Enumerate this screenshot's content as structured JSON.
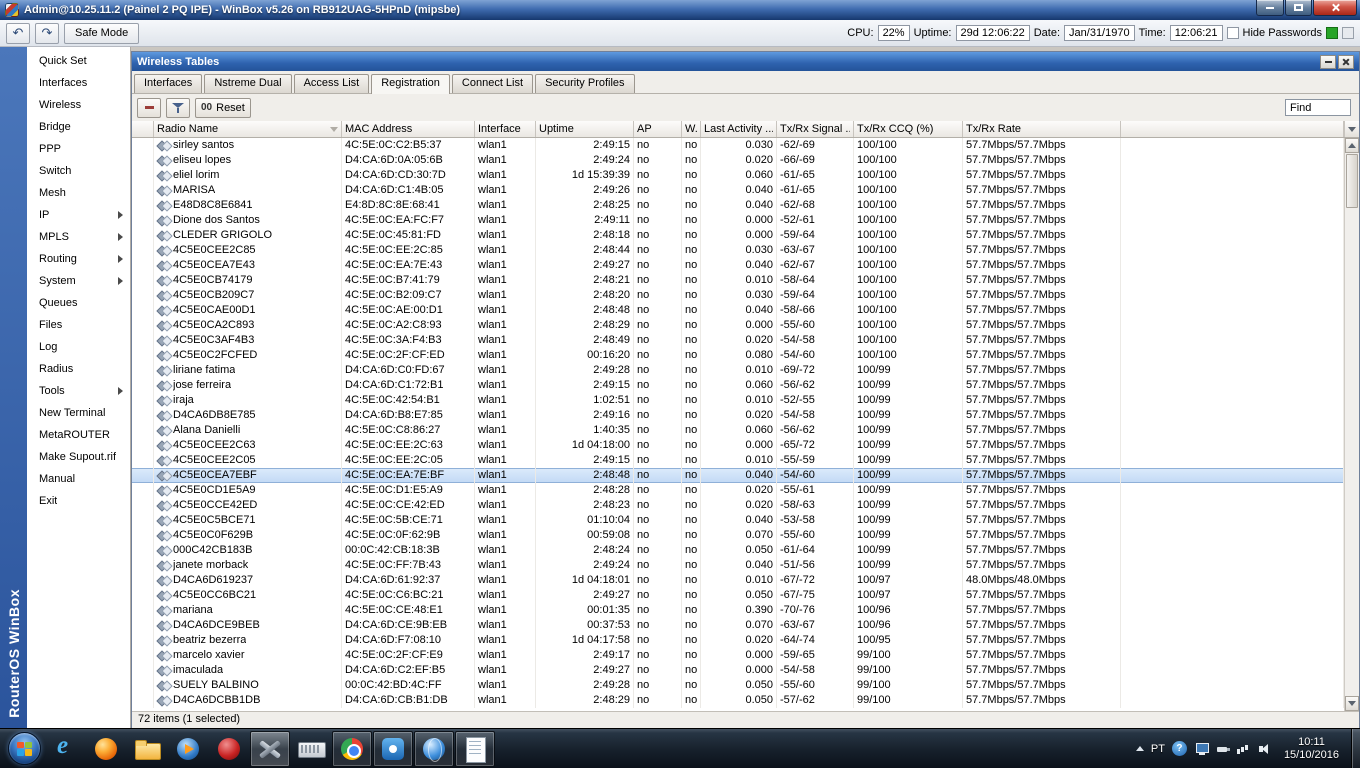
{
  "titlebar": {
    "title": "Admin@10.25.11.2 (Painel 2 PQ IPE) - WinBox v5.26 on RB912UAG-5HPnD (mipsbe)"
  },
  "toolbar": {
    "safe_mode_label": "Safe Mode",
    "cpu_label": "CPU:",
    "cpu_value": "22%",
    "uptime_label": "Uptime:",
    "uptime_value": "29d 12:06:22",
    "date_label": "Date:",
    "date_value": "Jan/31/1970",
    "time_label": "Time:",
    "time_value": "12:06:21",
    "hide_passwords_label": "Hide Passwords"
  },
  "sidebar": {
    "brand": "RouterOS WinBox",
    "items": [
      {
        "id": "quick-set",
        "label": "Quick Set"
      },
      {
        "id": "interfaces",
        "label": "Interfaces"
      },
      {
        "id": "wireless",
        "label": "Wireless"
      },
      {
        "id": "bridge",
        "label": "Bridge"
      },
      {
        "id": "ppp",
        "label": "PPP"
      },
      {
        "id": "switch",
        "label": "Switch"
      },
      {
        "id": "mesh",
        "label": "Mesh"
      },
      {
        "id": "ip",
        "label": "IP",
        "submenu": true
      },
      {
        "id": "mpls",
        "label": "MPLS",
        "submenu": true
      },
      {
        "id": "routing",
        "label": "Routing",
        "submenu": true
      },
      {
        "id": "system",
        "label": "System",
        "submenu": true
      },
      {
        "id": "queues",
        "label": "Queues"
      },
      {
        "id": "files",
        "label": "Files"
      },
      {
        "id": "log",
        "label": "Log"
      },
      {
        "id": "radius",
        "label": "Radius"
      },
      {
        "id": "tools",
        "label": "Tools",
        "submenu": true
      },
      {
        "id": "new-terminal",
        "label": "New Terminal"
      },
      {
        "id": "metarouter",
        "label": "MetaROUTER"
      },
      {
        "id": "make-supout",
        "label": "Make Supout.rif"
      },
      {
        "id": "manual",
        "label": "Manual"
      },
      {
        "id": "exit",
        "label": "Exit"
      }
    ]
  },
  "wireless_window": {
    "title": "Wireless Tables",
    "tabs": [
      {
        "id": "interfaces",
        "label": "Interfaces"
      },
      {
        "id": "nstreme-dual",
        "label": "Nstreme Dual"
      },
      {
        "id": "access-list",
        "label": "Access List"
      },
      {
        "id": "registration",
        "label": "Registration",
        "active": true
      },
      {
        "id": "connect-list",
        "label": "Connect List"
      },
      {
        "id": "security-profiles",
        "label": "Security Profiles"
      }
    ],
    "toolbar": {
      "reset_icon": "00",
      "reset_label": "Reset",
      "find_label": "Find"
    },
    "columns": [
      "Radio Name",
      "MAC Address",
      "Interface",
      "Uptime",
      "AP",
      "W...",
      "Last Activity ...",
      "Tx/Rx Signal ...",
      "Tx/Rx CCQ (%)",
      "Tx/Rx Rate"
    ],
    "rows": [
      {
        "name": "sirley santos",
        "mac": "4C:5E:0C:C2:B5:37",
        "iface": "wlan1",
        "uptime": "2:49:15",
        "ap": "no",
        "w": "no",
        "last": "0.030",
        "signal": "-62/-69",
        "ccq": "100/100",
        "rate": "57.7Mbps/57.7Mbps"
      },
      {
        "name": "eliseu lopes",
        "mac": "D4:CA:6D:0A:05:6B",
        "iface": "wlan1",
        "uptime": "2:49:24",
        "ap": "no",
        "w": "no",
        "last": "0.020",
        "signal": "-66/-69",
        "ccq": "100/100",
        "rate": "57.7Mbps/57.7Mbps"
      },
      {
        "name": "eliel lorim",
        "mac": "D4:CA:6D:CD:30:7D",
        "iface": "wlan1",
        "uptime": "1d 15:39:39",
        "ap": "no",
        "w": "no",
        "last": "0.060",
        "signal": "-61/-65",
        "ccq": "100/100",
        "rate": "57.7Mbps/57.7Mbps"
      },
      {
        "name": "MARISA",
        "mac": "D4:CA:6D:C1:4B:05",
        "iface": "wlan1",
        "uptime": "2:49:26",
        "ap": "no",
        "w": "no",
        "last": "0.040",
        "signal": "-61/-65",
        "ccq": "100/100",
        "rate": "57.7Mbps/57.7Mbps"
      },
      {
        "name": "E48D8C8E6841",
        "mac": "E4:8D:8C:8E:68:41",
        "iface": "wlan1",
        "uptime": "2:48:25",
        "ap": "no",
        "w": "no",
        "last": "0.040",
        "signal": "-62/-68",
        "ccq": "100/100",
        "rate": "57.7Mbps/57.7Mbps"
      },
      {
        "name": "Dione dos Santos",
        "mac": "4C:5E:0C:EA:FC:F7",
        "iface": "wlan1",
        "uptime": "2:49:11",
        "ap": "no",
        "w": "no",
        "last": "0.000",
        "signal": "-52/-61",
        "ccq": "100/100",
        "rate": "57.7Mbps/57.7Mbps"
      },
      {
        "name": "CLEDER GRIGOLO",
        "mac": "4C:5E:0C:45:81:FD",
        "iface": "wlan1",
        "uptime": "2:48:18",
        "ap": "no",
        "w": "no",
        "last": "0.000",
        "signal": "-59/-64",
        "ccq": "100/100",
        "rate": "57.7Mbps/57.7Mbps"
      },
      {
        "name": "4C5E0CEE2C85",
        "mac": "4C:5E:0C:EE:2C:85",
        "iface": "wlan1",
        "uptime": "2:48:44",
        "ap": "no",
        "w": "no",
        "last": "0.030",
        "signal": "-63/-67",
        "ccq": "100/100",
        "rate": "57.7Mbps/57.7Mbps"
      },
      {
        "name": "4C5E0CEA7E43",
        "mac": "4C:5E:0C:EA:7E:43",
        "iface": "wlan1",
        "uptime": "2:49:27",
        "ap": "no",
        "w": "no",
        "last": "0.040",
        "signal": "-62/-67",
        "ccq": "100/100",
        "rate": "57.7Mbps/57.7Mbps"
      },
      {
        "name": "4C5E0CB74179",
        "mac": "4C:5E:0C:B7:41:79",
        "iface": "wlan1",
        "uptime": "2:48:21",
        "ap": "no",
        "w": "no",
        "last": "0.010",
        "signal": "-58/-64",
        "ccq": "100/100",
        "rate": "57.7Mbps/57.7Mbps"
      },
      {
        "name": "4C5E0CB209C7",
        "mac": "4C:5E:0C:B2:09:C7",
        "iface": "wlan1",
        "uptime": "2:48:20",
        "ap": "no",
        "w": "no",
        "last": "0.030",
        "signal": "-59/-64",
        "ccq": "100/100",
        "rate": "57.7Mbps/57.7Mbps"
      },
      {
        "name": "4C5E0CAE00D1",
        "mac": "4C:5E:0C:AE:00:D1",
        "iface": "wlan1",
        "uptime": "2:48:48",
        "ap": "no",
        "w": "no",
        "last": "0.040",
        "signal": "-58/-66",
        "ccq": "100/100",
        "rate": "57.7Mbps/57.7Mbps"
      },
      {
        "name": "4C5E0CA2C893",
        "mac": "4C:5E:0C:A2:C8:93",
        "iface": "wlan1",
        "uptime": "2:48:29",
        "ap": "no",
        "w": "no",
        "last": "0.000",
        "signal": "-55/-60",
        "ccq": "100/100",
        "rate": "57.7Mbps/57.7Mbps"
      },
      {
        "name": "4C5E0C3AF4B3",
        "mac": "4C:5E:0C:3A:F4:B3",
        "iface": "wlan1",
        "uptime": "2:48:49",
        "ap": "no",
        "w": "no",
        "last": "0.020",
        "signal": "-54/-58",
        "ccq": "100/100",
        "rate": "57.7Mbps/57.7Mbps"
      },
      {
        "name": "4C5E0C2FCFED",
        "mac": "4C:5E:0C:2F:CF:ED",
        "iface": "wlan1",
        "uptime": "00:16:20",
        "ap": "no",
        "w": "no",
        "last": "0.080",
        "signal": "-54/-60",
        "ccq": "100/100",
        "rate": "57.7Mbps/57.7Mbps"
      },
      {
        "name": "liriane fatima",
        "mac": "D4:CA:6D:C0:FD:67",
        "iface": "wlan1",
        "uptime": "2:49:28",
        "ap": "no",
        "w": "no",
        "last": "0.010",
        "signal": "-69/-72",
        "ccq": "100/99",
        "rate": "57.7Mbps/57.7Mbps"
      },
      {
        "name": "jose ferreira",
        "mac": "D4:CA:6D:C1:72:B1",
        "iface": "wlan1",
        "uptime": "2:49:15",
        "ap": "no",
        "w": "no",
        "last": "0.060",
        "signal": "-56/-62",
        "ccq": "100/99",
        "rate": "57.7Mbps/57.7Mbps"
      },
      {
        "name": "iraja",
        "mac": "4C:5E:0C:42:54:B1",
        "iface": "wlan1",
        "uptime": "1:02:51",
        "ap": "no",
        "w": "no",
        "last": "0.010",
        "signal": "-52/-55",
        "ccq": "100/99",
        "rate": "57.7Mbps/57.7Mbps"
      },
      {
        "name": "D4CA6DB8E785",
        "mac": "D4:CA:6D:B8:E7:85",
        "iface": "wlan1",
        "uptime": "2:49:16",
        "ap": "no",
        "w": "no",
        "last": "0.020",
        "signal": "-54/-58",
        "ccq": "100/99",
        "rate": "57.7Mbps/57.7Mbps"
      },
      {
        "name": "Alana Danielli",
        "mac": "4C:5E:0C:C8:86:27",
        "iface": "wlan1",
        "uptime": "1:40:35",
        "ap": "no",
        "w": "no",
        "last": "0.060",
        "signal": "-56/-62",
        "ccq": "100/99",
        "rate": "57.7Mbps/57.7Mbps"
      },
      {
        "name": "4C5E0CEE2C63",
        "mac": "4C:5E:0C:EE:2C:63",
        "iface": "wlan1",
        "uptime": "1d 04:18:00",
        "ap": "no",
        "w": "no",
        "last": "0.000",
        "signal": "-65/-72",
        "ccq": "100/99",
        "rate": "57.7Mbps/57.7Mbps"
      },
      {
        "name": "4C5E0CEE2C05",
        "mac": "4C:5E:0C:EE:2C:05",
        "iface": "wlan1",
        "uptime": "2:49:15",
        "ap": "no",
        "w": "no",
        "last": "0.010",
        "signal": "-55/-59",
        "ccq": "100/99",
        "rate": "57.7Mbps/57.7Mbps"
      },
      {
        "name": "4C5E0CEA7EBF",
        "mac": "4C:5E:0C:EA:7E:BF",
        "iface": "wlan1",
        "uptime": "2:48:48",
        "ap": "no",
        "w": "no",
        "last": "0.040",
        "signal": "-54/-60",
        "ccq": "100/99",
        "rate": "57.7Mbps/57.7Mbps",
        "selected": true
      },
      {
        "name": "4C5E0CD1E5A9",
        "mac": "4C:5E:0C:D1:E5:A9",
        "iface": "wlan1",
        "uptime": "2:48:28",
        "ap": "no",
        "w": "no",
        "last": "0.020",
        "signal": "-55/-61",
        "ccq": "100/99",
        "rate": "57.7Mbps/57.7Mbps"
      },
      {
        "name": "4C5E0CCE42ED",
        "mac": "4C:5E:0C:CE:42:ED",
        "iface": "wlan1",
        "uptime": "2:48:23",
        "ap": "no",
        "w": "no",
        "last": "0.020",
        "signal": "-58/-63",
        "ccq": "100/99",
        "rate": "57.7Mbps/57.7Mbps"
      },
      {
        "name": "4C5E0C5BCE71",
        "mac": "4C:5E:0C:5B:CE:71",
        "iface": "wlan1",
        "uptime": "01:10:04",
        "ap": "no",
        "w": "no",
        "last": "0.040",
        "signal": "-53/-58",
        "ccq": "100/99",
        "rate": "57.7Mbps/57.7Mbps"
      },
      {
        "name": "4C5E0C0F629B",
        "mac": "4C:5E:0C:0F:62:9B",
        "iface": "wlan1",
        "uptime": "00:59:08",
        "ap": "no",
        "w": "no",
        "last": "0.070",
        "signal": "-55/-60",
        "ccq": "100/99",
        "rate": "57.7Mbps/57.7Mbps"
      },
      {
        "name": "000C42CB183B",
        "mac": "00:0C:42:CB:18:3B",
        "iface": "wlan1",
        "uptime": "2:48:24",
        "ap": "no",
        "w": "no",
        "last": "0.050",
        "signal": "-61/-64",
        "ccq": "100/99",
        "rate": "57.7Mbps/57.7Mbps"
      },
      {
        "name": "janete morback",
        "mac": "4C:5E:0C:FF:7B:43",
        "iface": "wlan1",
        "uptime": "2:49:24",
        "ap": "no",
        "w": "no",
        "last": "0.040",
        "signal": "-51/-56",
        "ccq": "100/99",
        "rate": "57.7Mbps/57.7Mbps"
      },
      {
        "name": "D4CA6D619237",
        "mac": "D4:CA:6D:61:92:37",
        "iface": "wlan1",
        "uptime": "1d 04:18:01",
        "ap": "no",
        "w": "no",
        "last": "0.010",
        "signal": "-67/-72",
        "ccq": "100/97",
        "rate": "48.0Mbps/48.0Mbps"
      },
      {
        "name": "4C5E0CC6BC21",
        "mac": "4C:5E:0C:C6:BC:21",
        "iface": "wlan1",
        "uptime": "2:49:27",
        "ap": "no",
        "w": "no",
        "last": "0.050",
        "signal": "-67/-75",
        "ccq": "100/97",
        "rate": "57.7Mbps/57.7Mbps"
      },
      {
        "name": "mariana",
        "mac": "4C:5E:0C:CE:48:E1",
        "iface": "wlan1",
        "uptime": "00:01:35",
        "ap": "no",
        "w": "no",
        "last": "0.390",
        "signal": "-70/-76",
        "ccq": "100/96",
        "rate": "57.7Mbps/57.7Mbps"
      },
      {
        "name": "D4CA6DCE9BEB",
        "mac": "D4:CA:6D:CE:9B:EB",
        "iface": "wlan1",
        "uptime": "00:37:53",
        "ap": "no",
        "w": "no",
        "last": "0.070",
        "signal": "-63/-67",
        "ccq": "100/96",
        "rate": "57.7Mbps/57.7Mbps"
      },
      {
        "name": "beatriz bezerra",
        "mac": "D4:CA:6D:F7:08:10",
        "iface": "wlan1",
        "uptime": "1d 04:17:58",
        "ap": "no",
        "w": "no",
        "last": "0.020",
        "signal": "-64/-74",
        "ccq": "100/95",
        "rate": "57.7Mbps/57.7Mbps"
      },
      {
        "name": "marcelo xavier",
        "mac": "4C:5E:0C:2F:CF:E9",
        "iface": "wlan1",
        "uptime": "2:49:17",
        "ap": "no",
        "w": "no",
        "last": "0.000",
        "signal": "-59/-65",
        "ccq": "99/100",
        "rate": "57.7Mbps/57.7Mbps"
      },
      {
        "name": "imaculada",
        "mac": "D4:CA:6D:C2:EF:B5",
        "iface": "wlan1",
        "uptime": "2:49:27",
        "ap": "no",
        "w": "no",
        "last": "0.000",
        "signal": "-54/-58",
        "ccq": "99/100",
        "rate": "57.7Mbps/57.7Mbps"
      },
      {
        "name": "SUELY BALBINO",
        "mac": "00:0C:42:BD:4C:FF",
        "iface": "wlan1",
        "uptime": "2:49:28",
        "ap": "no",
        "w": "no",
        "last": "0.050",
        "signal": "-55/-60",
        "ccq": "99/100",
        "rate": "57.7Mbps/57.7Mbps"
      },
      {
        "name": "D4CA6DCBB1DB",
        "mac": "D4:CA:6D:CB:B1:DB",
        "iface": "wlan1",
        "uptime": "2:48:29",
        "ap": "no",
        "w": "no",
        "last": "0.050",
        "signal": "-57/-62",
        "ccq": "99/100",
        "rate": "57.7Mbps/57.7Mbps"
      }
    ],
    "status": "72 items (1 selected)"
  },
  "taskbar": {
    "apps": [
      {
        "id": "ie"
      },
      {
        "id": "firefox"
      },
      {
        "id": "folder"
      },
      {
        "id": "media-player"
      },
      {
        "id": "media-red"
      },
      {
        "id": "winbox",
        "open": true,
        "active": true
      },
      {
        "id": "keyboard"
      },
      {
        "id": "chrome",
        "open": true
      },
      {
        "id": "remote-app",
        "open": true
      },
      {
        "id": "globe",
        "open": true
      },
      {
        "id": "notepad",
        "open": true
      }
    ],
    "tray": {
      "language": "PT",
      "icons": [
        "display",
        "usb",
        "network",
        "volume"
      ],
      "time": "10:11",
      "date": "15/10/2016"
    }
  }
}
